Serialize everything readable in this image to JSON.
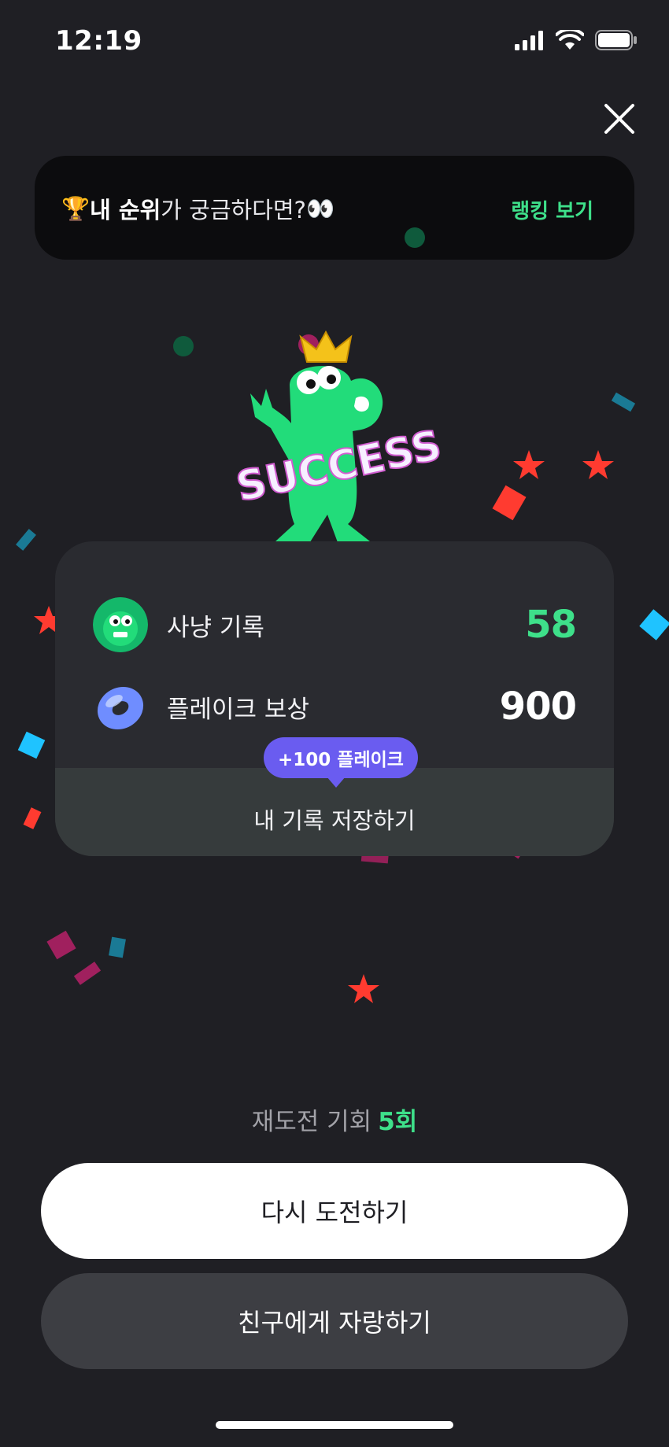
{
  "status_bar": {
    "time": "12:19"
  },
  "rank_banner": {
    "prefix_emoji": "🏆",
    "bold_text": "내 순위",
    "text": "가 궁금하다면? ",
    "suffix_emoji": "👀",
    "link_label": "랭킹 보기"
  },
  "mascot": {
    "text": "SUCCESS"
  },
  "record_card": {
    "hunting": {
      "label": "사냥 기록",
      "value": "58"
    },
    "reward": {
      "label": "플레이크 보상",
      "value": "900"
    },
    "tooltip": "+100 플레이크",
    "save_label": "내 기록 저장하기"
  },
  "retry": {
    "label": "재도전 기회",
    "count": "5회"
  },
  "buttons": {
    "retry": "다시 도전하기",
    "share": "친구에게 자랑하기"
  },
  "colors": {
    "background": "#1f1f24",
    "accent_green": "#3ee08a",
    "tooltip_purple": "#6a5cf0",
    "card": "#2a2b30"
  },
  "icons": [
    "signal-icon",
    "wifi-icon",
    "battery-icon",
    "close-icon",
    "trophy-emoji",
    "eyes-emoji",
    "monster-avatar-icon",
    "donut-icon"
  ]
}
